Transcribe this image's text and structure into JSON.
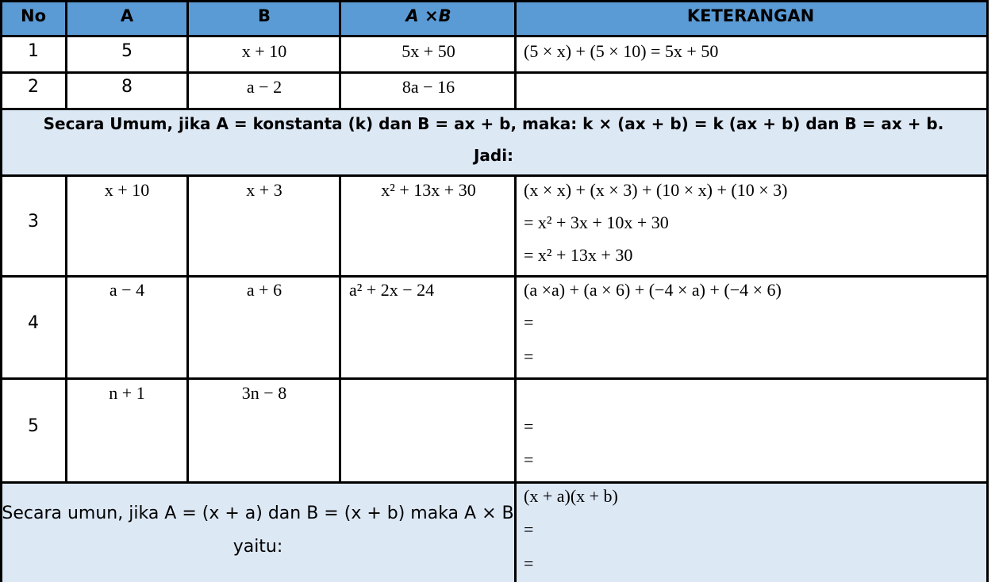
{
  "header": {
    "no": "No",
    "a": "A",
    "b": "B",
    "axb": "A ×B",
    "keterangan": "KETERANGAN"
  },
  "rows": [
    {
      "no": "1",
      "a": "5",
      "b": "x + 10",
      "axb": "5x + 50",
      "ket": [
        "(5 × x) + (5 × 10) = 5x + 50"
      ]
    },
    {
      "no": "2",
      "a": "8",
      "b": "a − 2",
      "axb": "8a − 16",
      "ket": []
    },
    {
      "no": "3",
      "a": "x + 10",
      "b": "x + 3",
      "axb": "x² + 13x + 30",
      "ket": [
        "(x × x) + (x × 3) + (10 × x) + (10 × 3)",
        "= x² + 3x + 10x + 30",
        "= x² + 13x + 30"
      ]
    },
    {
      "no": "4",
      "a": "a − 4",
      "b": "a + 6",
      "axb": "a² + 2x − 24",
      "ket": [
        "(a ×a) + (a × 6) + (−4 × a) + (−4 × 6)",
        "=",
        "="
      ]
    },
    {
      "no": "5",
      "a": "n + 1",
      "b": "3n − 8",
      "axb": "",
      "ket": [
        "=",
        "="
      ]
    }
  ],
  "general1": {
    "line1": "Secara Umum, jika A = konstanta (k) dan B = ax + b, maka: k × (ax + b) = k (ax + b) dan B = ax + b.",
    "line2": "Jadi:"
  },
  "general2": {
    "left_line1": "Secara umun, jika A = (x + a) dan B = (x + b) maka A × B",
    "left_line2": "yaitu:",
    "right": [
      "(x + a)(x + b)",
      "=",
      "="
    ]
  },
  "colors": {
    "header_bg": "#5b9bd5",
    "section_bg": "#dde8f5",
    "border": "#000000"
  }
}
